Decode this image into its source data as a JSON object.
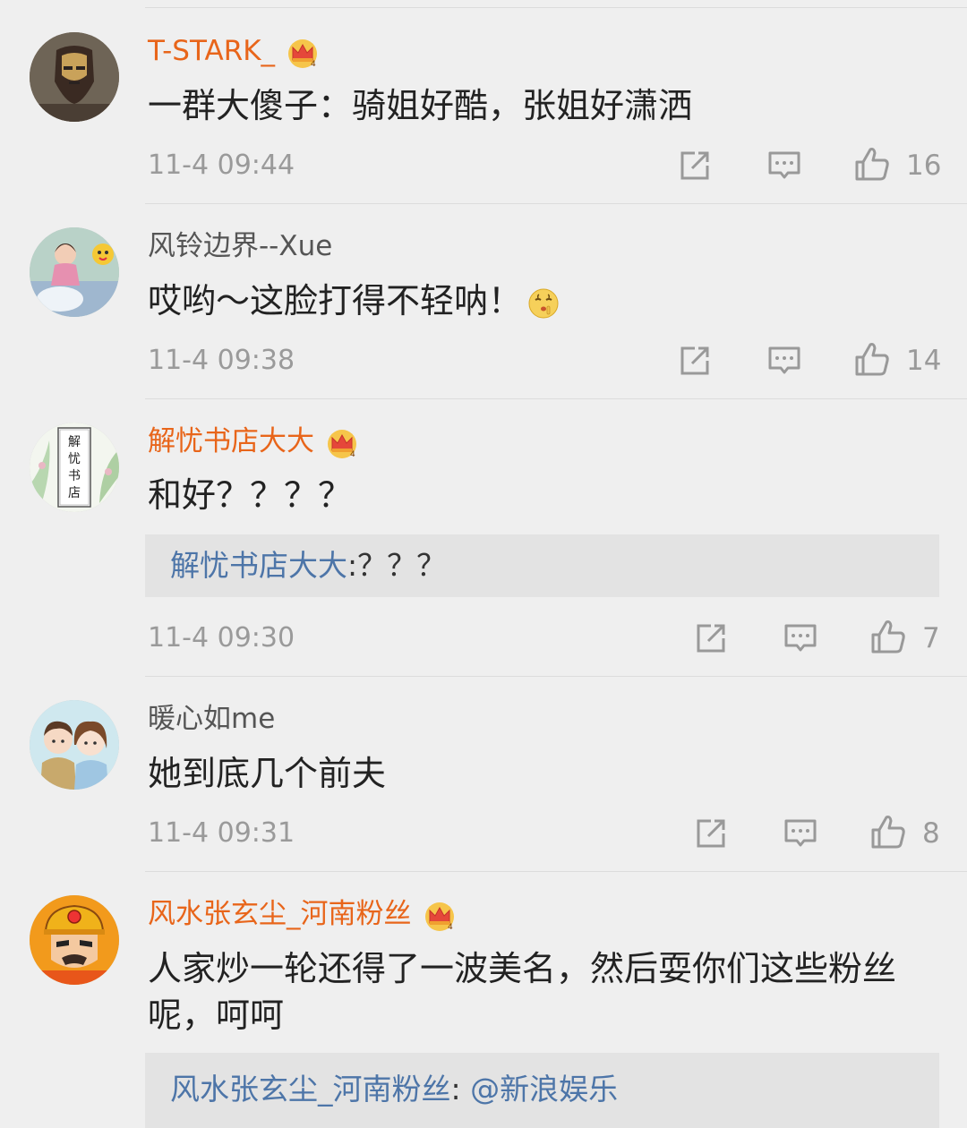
{
  "comments": [
    {
      "username": "T-STARK_",
      "vip": true,
      "avatar_icon": "iron-man-avatar-icon",
      "text": "一群大傻子：骑姐好酷，张姐好潇洒",
      "time": "11-4 09:44",
      "likes": "16"
    },
    {
      "username": "风铃边界--Xue",
      "vip": false,
      "avatar_icon": "child-photo-avatar-icon",
      "text": "哎哟～这脸打得不轻呐！",
      "emoji": "shush-emoji-icon",
      "time": "11-4 09:38",
      "likes": "14"
    },
    {
      "username": "解忧书店大大",
      "vip": true,
      "avatar_icon": "bookstore-avatar-icon",
      "avatar_text": "解忧书店",
      "text": "和好？？？？",
      "reply": {
        "name": "解忧书店大大",
        "sep": ":",
        "text": "？？？"
      },
      "time": "11-4 09:30",
      "likes": "7"
    },
    {
      "username": "暖心如me",
      "vip": false,
      "avatar_icon": "couple-cartoon-avatar-icon",
      "text": "她到底几个前夫",
      "time": "11-4 09:31",
      "likes": "8"
    },
    {
      "username": "风水张玄尘_河南粉丝",
      "vip": true,
      "avatar_icon": "cartoon-worker-avatar-icon",
      "text": "人家炒一轮还得了一波美名，然后耍你们这些粉丝呢，呵呵",
      "reply": {
        "name": "风水张玄尘_河南粉丝",
        "sep": ": ",
        "text": "@新浪娱乐"
      }
    }
  ],
  "colors": {
    "background": "#efefef",
    "vip_username": "#e8651a",
    "username": "#555555",
    "reply_name": "#4d75a8",
    "meta": "#9a9a9a"
  },
  "icons": [
    "share-icon",
    "comment-icon",
    "like-icon",
    "vip-crown-icon"
  ]
}
